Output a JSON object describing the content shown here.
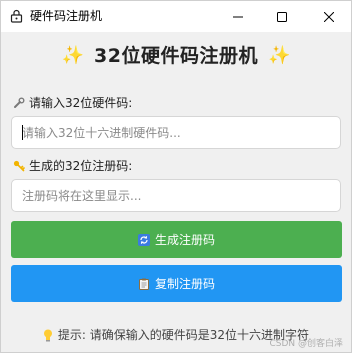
{
  "window": {
    "title": "硬件码注册机",
    "controls": [
      "minimize-icon",
      "maximize-icon",
      "close-icon"
    ]
  },
  "heading": {
    "icon": "sparkles-icon",
    "text": "32位硬件码注册机"
  },
  "hardware": {
    "icon": "wrench-icon",
    "label": "请输入32位硬件码:",
    "placeholder": "请输入32位十六进制硬件码...",
    "value": ""
  },
  "registration": {
    "icon": "key-icon",
    "label": "生成的32位注册码:",
    "placeholder": "注册码将在这里显示...",
    "value": ""
  },
  "buttons": {
    "generate": {
      "icon": "refresh-icon",
      "label": "生成注册码",
      "color": "#4caf50"
    },
    "copy": {
      "icon": "clipboard-icon",
      "label": "复制注册码",
      "color": "#2196f3"
    }
  },
  "hint": {
    "icon": "lightbulb-icon",
    "text": "提示: 请确保输入的硬件码是32位十六进制字符"
  },
  "watermark": "CSDN @创客白泽"
}
